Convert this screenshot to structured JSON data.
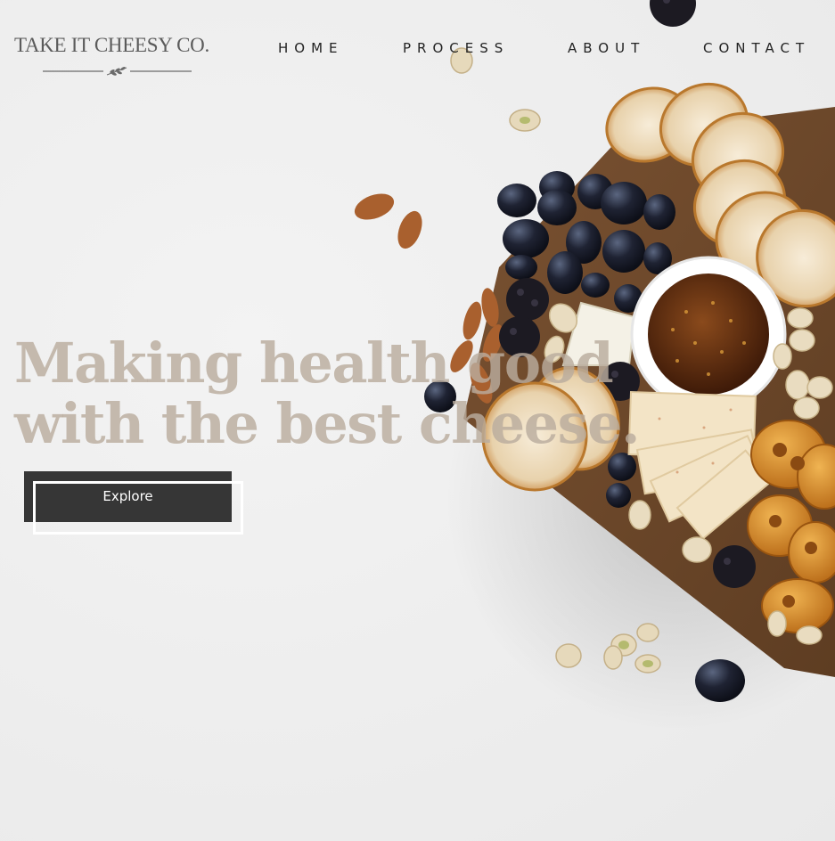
{
  "brand": {
    "logo_text": "TAKE IT CHEESY CO."
  },
  "nav": {
    "items": [
      {
        "label": "HOME"
      },
      {
        "label": "PROCESS"
      },
      {
        "label": "ABOUT"
      },
      {
        "label": "CONTACT"
      }
    ]
  },
  "hero": {
    "heading_line1": "Making health good",
    "heading_line2": "with the best cheese.",
    "cta_label": "Explore"
  },
  "colors": {
    "background": "#efefef",
    "heading": "#b9ac9e",
    "button": "#363636",
    "nav_text": "#222222"
  }
}
